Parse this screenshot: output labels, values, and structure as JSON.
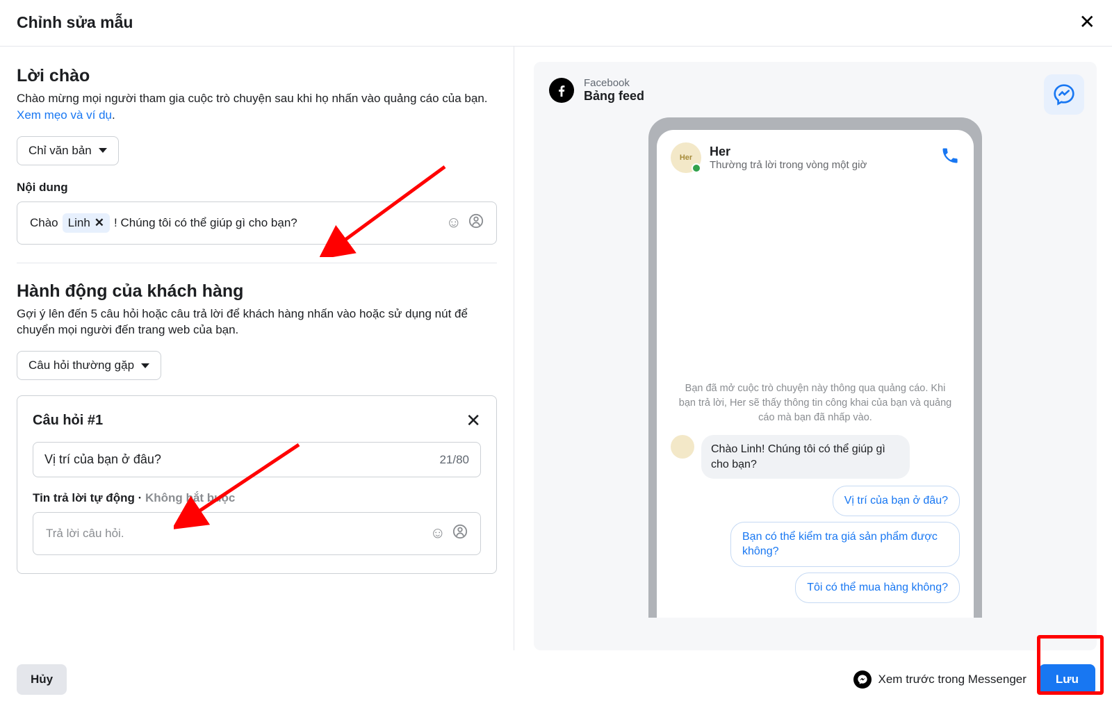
{
  "header": {
    "title": "Chỉnh sửa mẫu"
  },
  "greeting": {
    "heading": "Lời chào",
    "desc_pre": "Chào mừng mọi người tham gia cuộc trò chuyện sau khi họ nhấn vào quảng cáo của bạn. ",
    "desc_link": "Xem mẹo và ví dụ",
    "format_select": "Chỉ văn bản",
    "content_label": "Nội dung",
    "text_pre": "Chào ",
    "chip": "Linh",
    "text_post": " ! Chúng tôi có thể giúp gì cho bạn?"
  },
  "actions": {
    "heading": "Hành động của khách hàng",
    "desc": "Gợi ý lên đến 5 câu hỏi hoặc câu trả lời để khách hàng nhấn vào hoặc sử dụng nút để chuyển mọi người đến trang web của bạn.",
    "type_select": "Câu hỏi thường gặp",
    "question": {
      "title": "Câu hỏi #1",
      "value": "Vị trí của bạn ở đâu?",
      "counter": "21/80",
      "auto_label": "Tin trả lời tự động",
      "optional": "Không bắt buộc",
      "answer_placeholder": "Trả lời câu hỏi."
    }
  },
  "preview": {
    "platform": "Facebook",
    "surface": "Bảng feed",
    "page_name": "Her",
    "response_time": "Thường trả lời trong vòng một giờ",
    "disclaimer": "Bạn đã mở cuộc trò chuyện này thông qua quảng cáo. Khi bạn trả lời, Her sẽ thấy thông tin công khai của bạn và quảng cáo mà bạn đã nhấp vào.",
    "incoming": "Chào Linh! Chúng tôi có thể giúp gì cho bạn?",
    "quick_replies": [
      "Vị trí của bạn ở đâu?",
      "Bạn có thể kiểm tra giá sản phẩm được không?",
      "Tôi có thể mua hàng không?"
    ]
  },
  "footer": {
    "cancel": "Hủy",
    "preview_label": "Xem trước trong Messenger",
    "save": "Lưu"
  }
}
